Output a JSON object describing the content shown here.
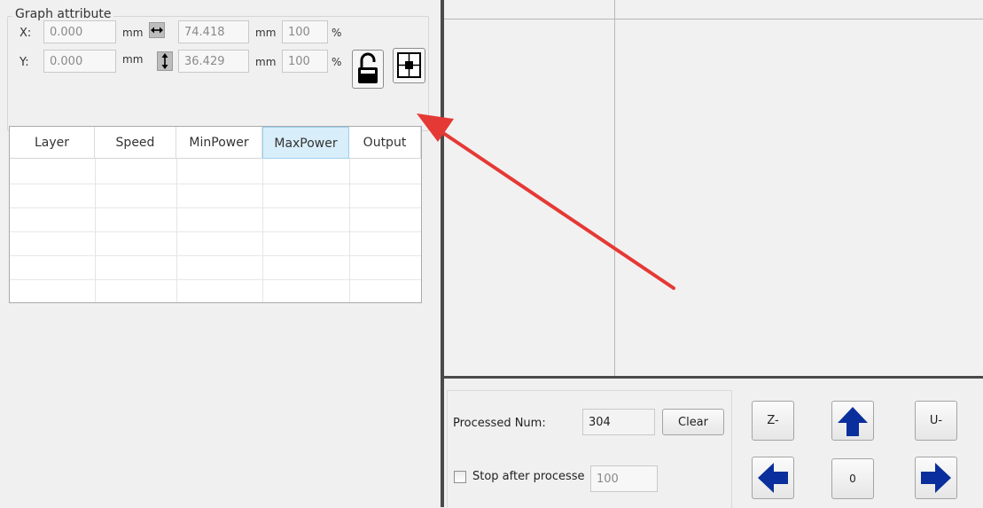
{
  "graph_attribute": {
    "title": "Graph attribute",
    "x_label": "X:",
    "y_label": "Y:",
    "x_value": "0.000",
    "y_value": "0.000",
    "width_value": "74.418",
    "height_value": "36.429",
    "width_percent": "100",
    "height_percent": "100",
    "unit": "mm",
    "percent_sign": "%",
    "icons": {
      "width": "horizontal-arrows-icon",
      "height": "vertical-arrows-icon",
      "lock": "padlock-icon",
      "center": "center-grid-icon"
    }
  },
  "layer_table": {
    "columns": [
      "Layer",
      "Speed",
      "MinPower",
      "MaxPower",
      "Output"
    ],
    "selected_column": "MaxPower",
    "rows": []
  },
  "annotation": {
    "type": "red-arrow-icon",
    "color": "#e53935"
  },
  "process": {
    "processed_label": "Processed Num:",
    "processed_value": "304",
    "clear_label": "Clear",
    "stop_label": "Stop after processe",
    "stop_checked": false,
    "stop_value": "100"
  },
  "jog": {
    "z_minus": "Z-",
    "u_minus": "U-",
    "zero": "0",
    "arrow_color": "#0a2f9c",
    "icons": {
      "up": "arrow-up-icon",
      "left": "arrow-left-icon",
      "right": "arrow-right-icon"
    }
  }
}
